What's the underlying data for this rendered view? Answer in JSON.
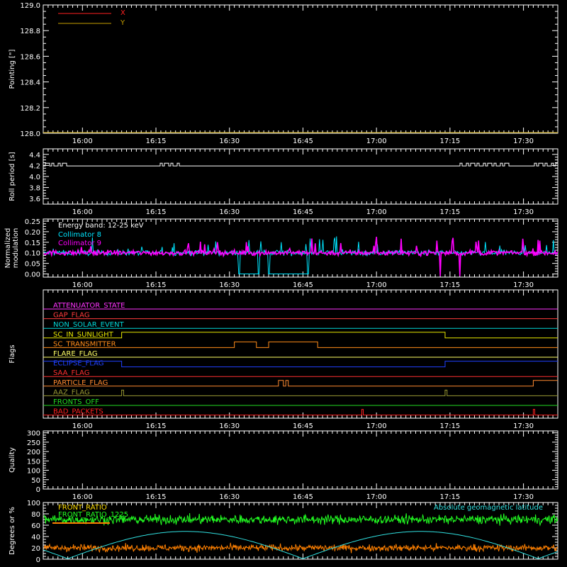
{
  "colors": {
    "background": "#000000",
    "frame": "#ffffff",
    "x": "#ff2020",
    "y": "#c8a000",
    "roll": "#ffffff",
    "coll8": "#00e5ff",
    "coll9": "#ff00ff",
    "front_ratio": "#ff8000",
    "front_ratio_1225": "#22ff22",
    "geolat": "#30e0e0"
  },
  "time_axis": {
    "start_minutes": 952,
    "end_minutes": 1057,
    "tick_labels": [
      "16:00",
      "16:15",
      "16:30",
      "16:45",
      "17:00",
      "17:15",
      "17:30"
    ],
    "tick_minutes": [
      960,
      975,
      990,
      1005,
      1020,
      1035,
      1050
    ],
    "minor_step_minutes": 1
  },
  "chart_data": [
    {
      "id": "pointing",
      "type": "line",
      "ylabel": "Pointing [\"]",
      "ylim": [
        128.0,
        129.0
      ],
      "yticks": [
        "128.0",
        "128.2",
        "128.4",
        "128.6",
        "128.8",
        "129.0"
      ],
      "ytick_values": [
        128.0,
        128.2,
        128.4,
        128.6,
        128.8,
        129.0
      ],
      "legend": [
        {
          "name": "X",
          "color": "#ff2020"
        },
        {
          "name": "Y",
          "color": "#c8a000"
        }
      ],
      "series": []
    },
    {
      "id": "roll",
      "type": "line",
      "ylabel": "Roll period [s]",
      "ylim": [
        3.5,
        4.5
      ],
      "yticks": [
        "3.6",
        "3.8",
        "4.0",
        "4.2",
        "4.4"
      ],
      "ytick_values": [
        3.6,
        3.8,
        4.0,
        4.2,
        4.4
      ],
      "series": [
        {
          "baseline": 4.19,
          "bump": 4.24,
          "active_ranges": [
            [
              952,
              957
            ],
            [
              975,
              980
            ],
            [
              1037,
              1047
            ],
            [
              1052,
              1057
            ]
          ]
        }
      ]
    },
    {
      "id": "modulation",
      "type": "line",
      "ylabel": "Normalized modulation",
      "ylim": [
        -0.015,
        0.26
      ],
      "yticks": [
        "0.00",
        "0.05",
        "0.10",
        "0.15",
        "0.20",
        "0.25"
      ],
      "ytick_values": [
        0.0,
        0.05,
        0.1,
        0.15,
        0.2,
        0.25
      ],
      "annotation": "Energy band: 12-25 keV",
      "series": [
        {
          "name": "Collimator 8",
          "color": "#00e5ff",
          "mean": 0.1,
          "dropout_minutes": [
            992,
            996,
            998,
            1006
          ]
        },
        {
          "name": "Collimator 9",
          "color": "#ff00ff",
          "mean": 0.1,
          "dropout_minutes": [
            1033,
            1037
          ]
        }
      ]
    },
    {
      "id": "flags",
      "type": "line",
      "ylabel": "Flags",
      "series": [
        {
          "name": "ATTENUATOR_STATE",
          "color": "#ff33ff",
          "high_ranges": []
        },
        {
          "name": "GAP_FLAG",
          "color": "#ff3b3b",
          "high_ranges": []
        },
        {
          "name": "NON_SOLAR_EVENT",
          "color": "#00d8d8",
          "high_ranges": []
        },
        {
          "name": "SC_IN_SUNLIGHT",
          "color": "#e6e600",
          "high_ranges": [
            [
              968,
              1034
            ]
          ]
        },
        {
          "name": "SC_TRANSMITTER",
          "color": "#ff8c1a",
          "high_ranges": [
            [
              991,
              995.5
            ],
            [
              998,
              1008
            ]
          ]
        },
        {
          "name": "FLARE_FLAG",
          "color": "#ffff66",
          "high_ranges": []
        },
        {
          "name": "ECLIPSE_FLAG",
          "color": "#2040ff",
          "high_ranges": [
            [
              952,
              968
            ],
            [
              1034,
              1057
            ]
          ]
        },
        {
          "name": "SAA_FLAG",
          "color": "#ff3030",
          "high_ranges": []
        },
        {
          "name": "PARTICLE_FLAG",
          "color": "#ff8a30",
          "high_ranges": [
            [
              1000,
              1001
            ],
            [
              1001.5,
              1002
            ],
            [
              1052,
              1057
            ]
          ]
        },
        {
          "name": "AAZ_FLAG",
          "color": "#999933",
          "high_ranges": [
            [
              968,
              968.4
            ],
            [
              1034,
              1034.4
            ]
          ]
        },
        {
          "name": "FRONTS_OFF",
          "color": "#22dd22",
          "high_ranges": []
        },
        {
          "name": "BAD_PACKETS",
          "color": "#ff2020",
          "high_ranges": [
            [
              1017,
              1017.3
            ],
            [
              1052,
              1052.3
            ]
          ]
        }
      ]
    },
    {
      "id": "quality",
      "type": "line",
      "ylabel": "Quality",
      "ylim": [
        0,
        310
      ],
      "yticks": [
        "0",
        "50",
        "100",
        "150",
        "200",
        "250",
        "300"
      ],
      "ytick_values": [
        0,
        50,
        100,
        150,
        200,
        250,
        300
      ],
      "series": []
    },
    {
      "id": "ratio",
      "type": "line",
      "ylabel": "Degrees or %",
      "ylim": [
        0,
        100
      ],
      "yticks": [
        "0",
        "20",
        "40",
        "60",
        "80",
        "100"
      ],
      "ytick_values": [
        0,
        20,
        40,
        60,
        80,
        100
      ],
      "series": [
        {
          "name": "FRONT_RATIO",
          "color": "#ff8000",
          "mean": 20
        },
        {
          "name": "FRONT_RATIO_1225",
          "color": "#22ff22",
          "mean": 70
        },
        {
          "name": "",
          "color": "#ff8000",
          "legend_note": true
        },
        {
          "name": "Absolute geomagnetic latitude",
          "color": "#30e0e0",
          "curve": "abs_sine",
          "amplitude": 48,
          "period_minutes": 48,
          "phase_minutes": 957
        }
      ]
    }
  ]
}
